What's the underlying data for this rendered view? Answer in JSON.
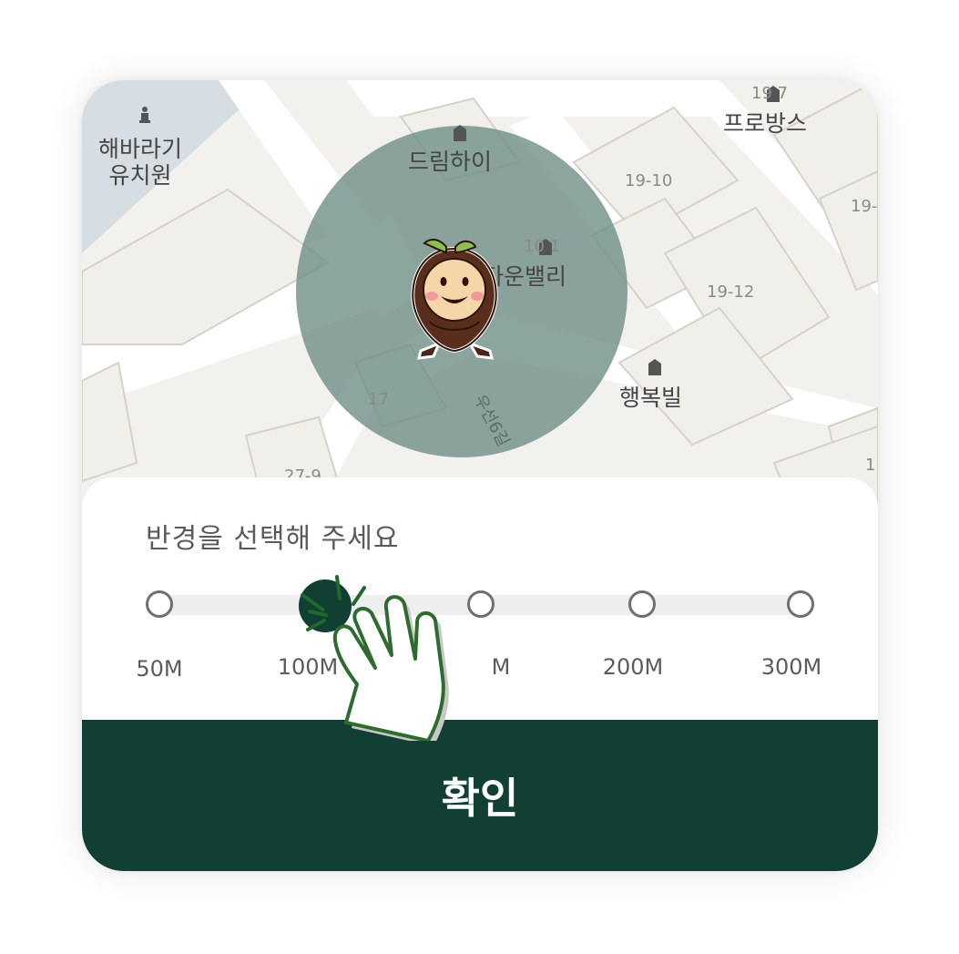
{
  "map": {
    "labels": {
      "kindergarten": "해바라기\n유치원",
      "dream_high": "드림하이",
      "town_valley": "타운밸리",
      "provence": "프로방스",
      "happy_vill": "행복빌"
    },
    "numbers": {
      "n19_10": "19-10",
      "n19_12": "19-12",
      "n17": "17",
      "n27_9": "27-9",
      "n19_7": "19 7",
      "n10_1": "10 1",
      "n19_right": "19-",
      "n1_edge": "1",
      "road": "우선6길"
    },
    "radius_overlay_color": "#6f8f86",
    "mascot": "chestnut-character"
  },
  "radius_sheet": {
    "title": "반경을 선택해 주세요",
    "options": [
      {
        "label": "50M",
        "selected": false
      },
      {
        "label": "100M",
        "selected": true
      },
      {
        "label": "M",
        "selected": false
      },
      {
        "label": "200M",
        "selected": false
      },
      {
        "label": "300M",
        "selected": false
      }
    ]
  },
  "confirm_button": {
    "label": "확인"
  },
  "colors": {
    "accent": "#123f33",
    "track": "#eeeeee",
    "stop_border": "#6f6f6f",
    "hand_outline": "#2e6b2f"
  },
  "icons": {
    "pointer": "tap-hand-icon",
    "building": "building-icon",
    "school": "kindergarten-icon"
  }
}
